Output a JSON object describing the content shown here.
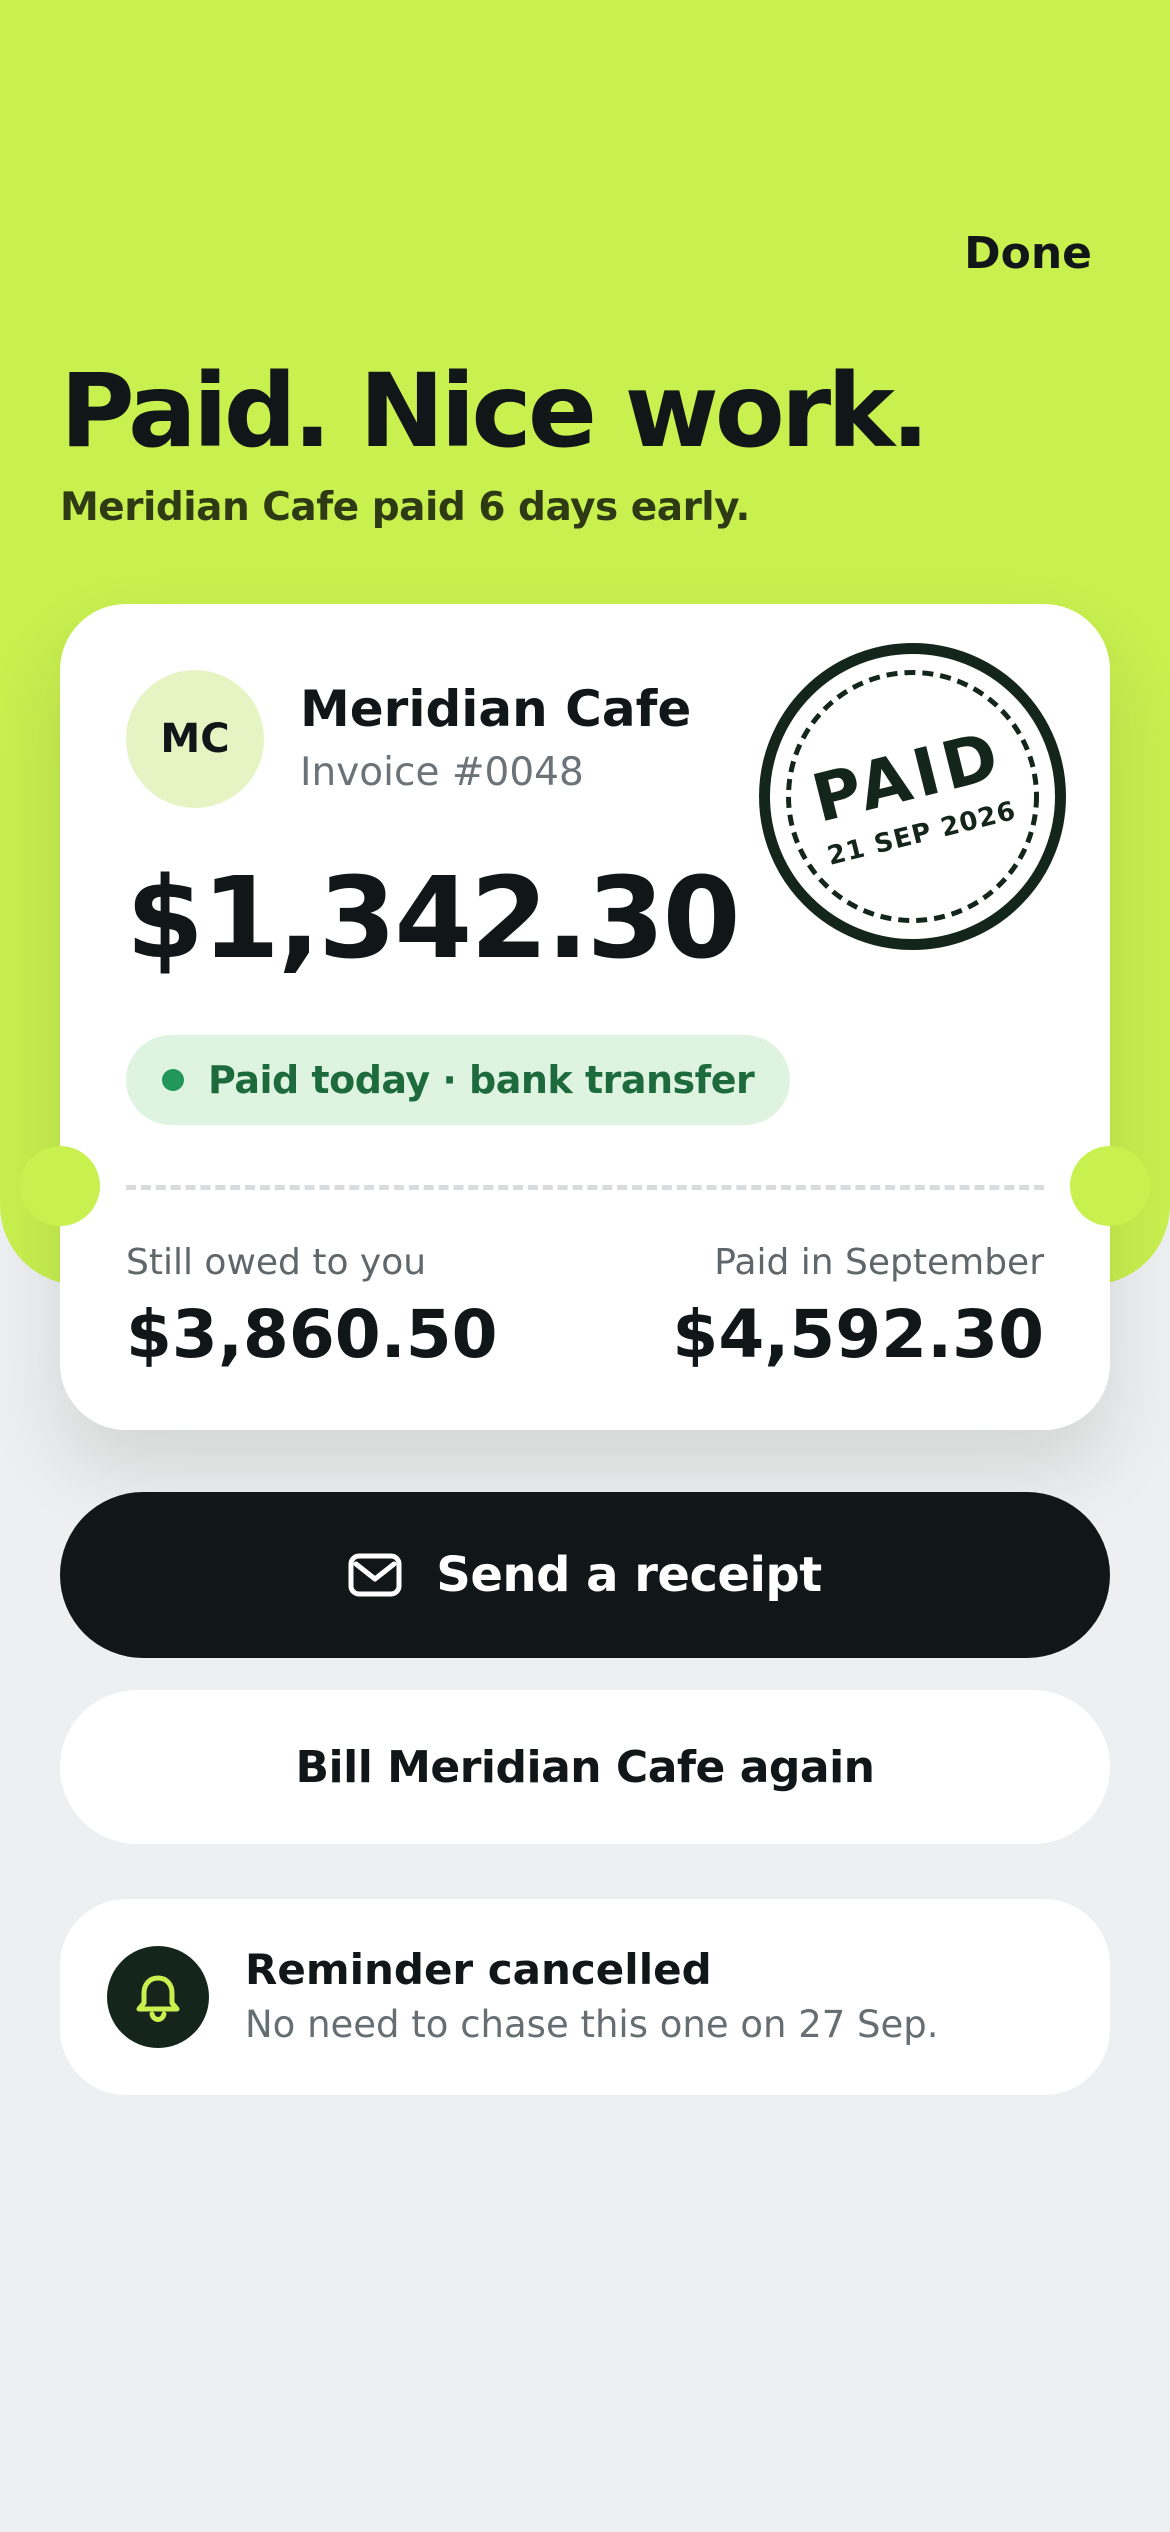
{
  "header": {
    "done_label": "Done"
  },
  "hero": {
    "title": "Paid. Nice work.",
    "subtitle": "Meridian Cafe paid 6 days early."
  },
  "invoice_card": {
    "avatar_initials": "MC",
    "client_name": "Meridian Cafe",
    "invoice_number": "Invoice #0048",
    "amount": "$1,342.30",
    "status_text": "Paid today · bank transfer",
    "stamp": {
      "label": "PAID",
      "date": "21 SEP 2026"
    },
    "stats": {
      "owed_label": "Still owed to you",
      "owed_value": "$3,860.50",
      "paid_label": "Paid in September",
      "paid_value": "$4,592.30"
    }
  },
  "actions": {
    "primary_label": "Send a receipt",
    "primary_icon": "mail-icon",
    "secondary_label": "Bill Meridian Cafe again"
  },
  "notice": {
    "icon": "bell-icon",
    "title": "Reminder cancelled",
    "body": "No need to chase this one on 27 Sep."
  },
  "colors": {
    "accent": "#c8f04f",
    "dark": "#111618",
    "success": "#23965a",
    "success_bg": "#dff3e1",
    "stamp": "#14261c"
  }
}
